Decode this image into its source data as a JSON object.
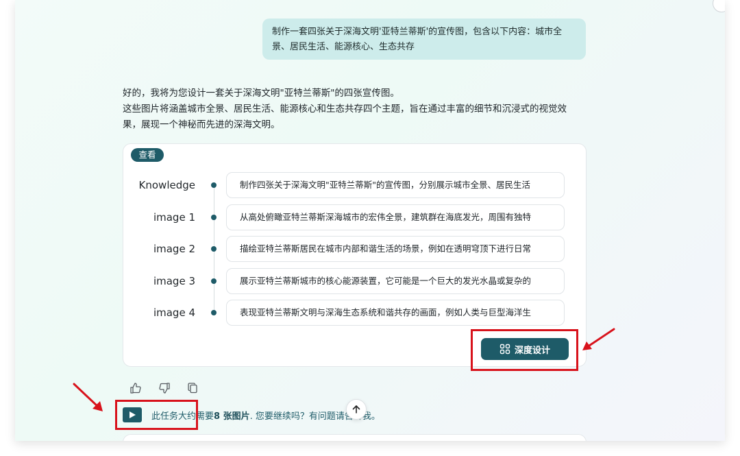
{
  "user_message": {
    "line1": "制作一套四张关于深海文明'亚特兰蒂斯'的宣传图，包含以下内容：城市全",
    "line2": "景、居民生活、能源核心、生态共存"
  },
  "assistant_reply": {
    "line1": "好的，我将为您设计一套关于深海文明\"亚特兰蒂斯\"的四张宣传图。",
    "line2": "这些图片将涵盖城市全景、居民生活、能源核心和生态共存四个主题，旨在通过丰富的细节和沉浸式的视觉效",
    "line3": "果，展现一个神秘而先进的深海文明。"
  },
  "card": {
    "view_chip": "查看",
    "rows": [
      {
        "label": "Knowledge",
        "text": "制作四张关于深海文明\"亚特兰蒂斯\"的宣传图，分别展示城市全景、居民生活"
      },
      {
        "label": "image 1",
        "text": "从高处俯瞰亚特兰蒂斯深海城市的宏伟全景，建筑群在海底发光，周围有独特"
      },
      {
        "label": "image 2",
        "text": "描绘亚特兰蒂斯居民在城市内部和谐生活的场景，例如在透明穹顶下进行日常"
      },
      {
        "label": "image 3",
        "text": "展示亚特兰蒂斯城市的核心能源装置，它可能是一个巨大的发光水晶或复杂的"
      },
      {
        "label": "image 4",
        "text": "表现亚特兰蒂斯文明与深海生态系统和谐共存的画面，例如人类与巨型海洋生"
      }
    ],
    "deep_design_label": "深度设计"
  },
  "task_prompt": {
    "prefix": "此任务大约需要 ",
    "bold": "8 张图片",
    "suffix": ". 您要继续吗？有问题请告诉我。"
  },
  "icons": {
    "thumbs_up": "thumbs-up-icon",
    "thumbs_down": "thumbs-down-icon",
    "copy": "copy-icon",
    "play": "play-icon",
    "scroll_top": "arrow-up-icon",
    "deep_design": "grid-icon"
  },
  "colors": {
    "accent": "#1e5b68",
    "user_bubble": "#cdeceb",
    "annotation_red": "#d8121b"
  }
}
